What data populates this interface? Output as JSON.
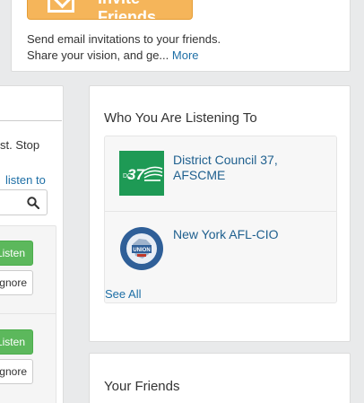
{
  "invite": {
    "button_label": "Invite Friends",
    "description_line1": "Send email invitations to your friends.",
    "description_line2": "Share your vision, and ge...",
    "more_link": "More"
  },
  "left_panel": {
    "text_fragment": "st. Stop",
    "link_fragment": "listen to",
    "rows": [
      {
        "listen_label": "Listen",
        "ignore_label": "gnore"
      },
      {
        "listen_label": "Listen",
        "ignore_label": "gnore"
      }
    ]
  },
  "listening": {
    "title": "Who You Are Listening To",
    "organizations": [
      {
        "name": "District Council 37, AFSCME",
        "logo_text": "37"
      },
      {
        "name": "New York AFL-CIO",
        "logo_text": "UNION"
      }
    ],
    "see_all": "See All"
  },
  "friends": {
    "title": "Your Friends"
  },
  "colors": {
    "accent_link": "#1e6fa6",
    "invite_orange": "#f5b55a",
    "listen_green": "#5cb85c",
    "dc37_green": "#1e9a55"
  }
}
